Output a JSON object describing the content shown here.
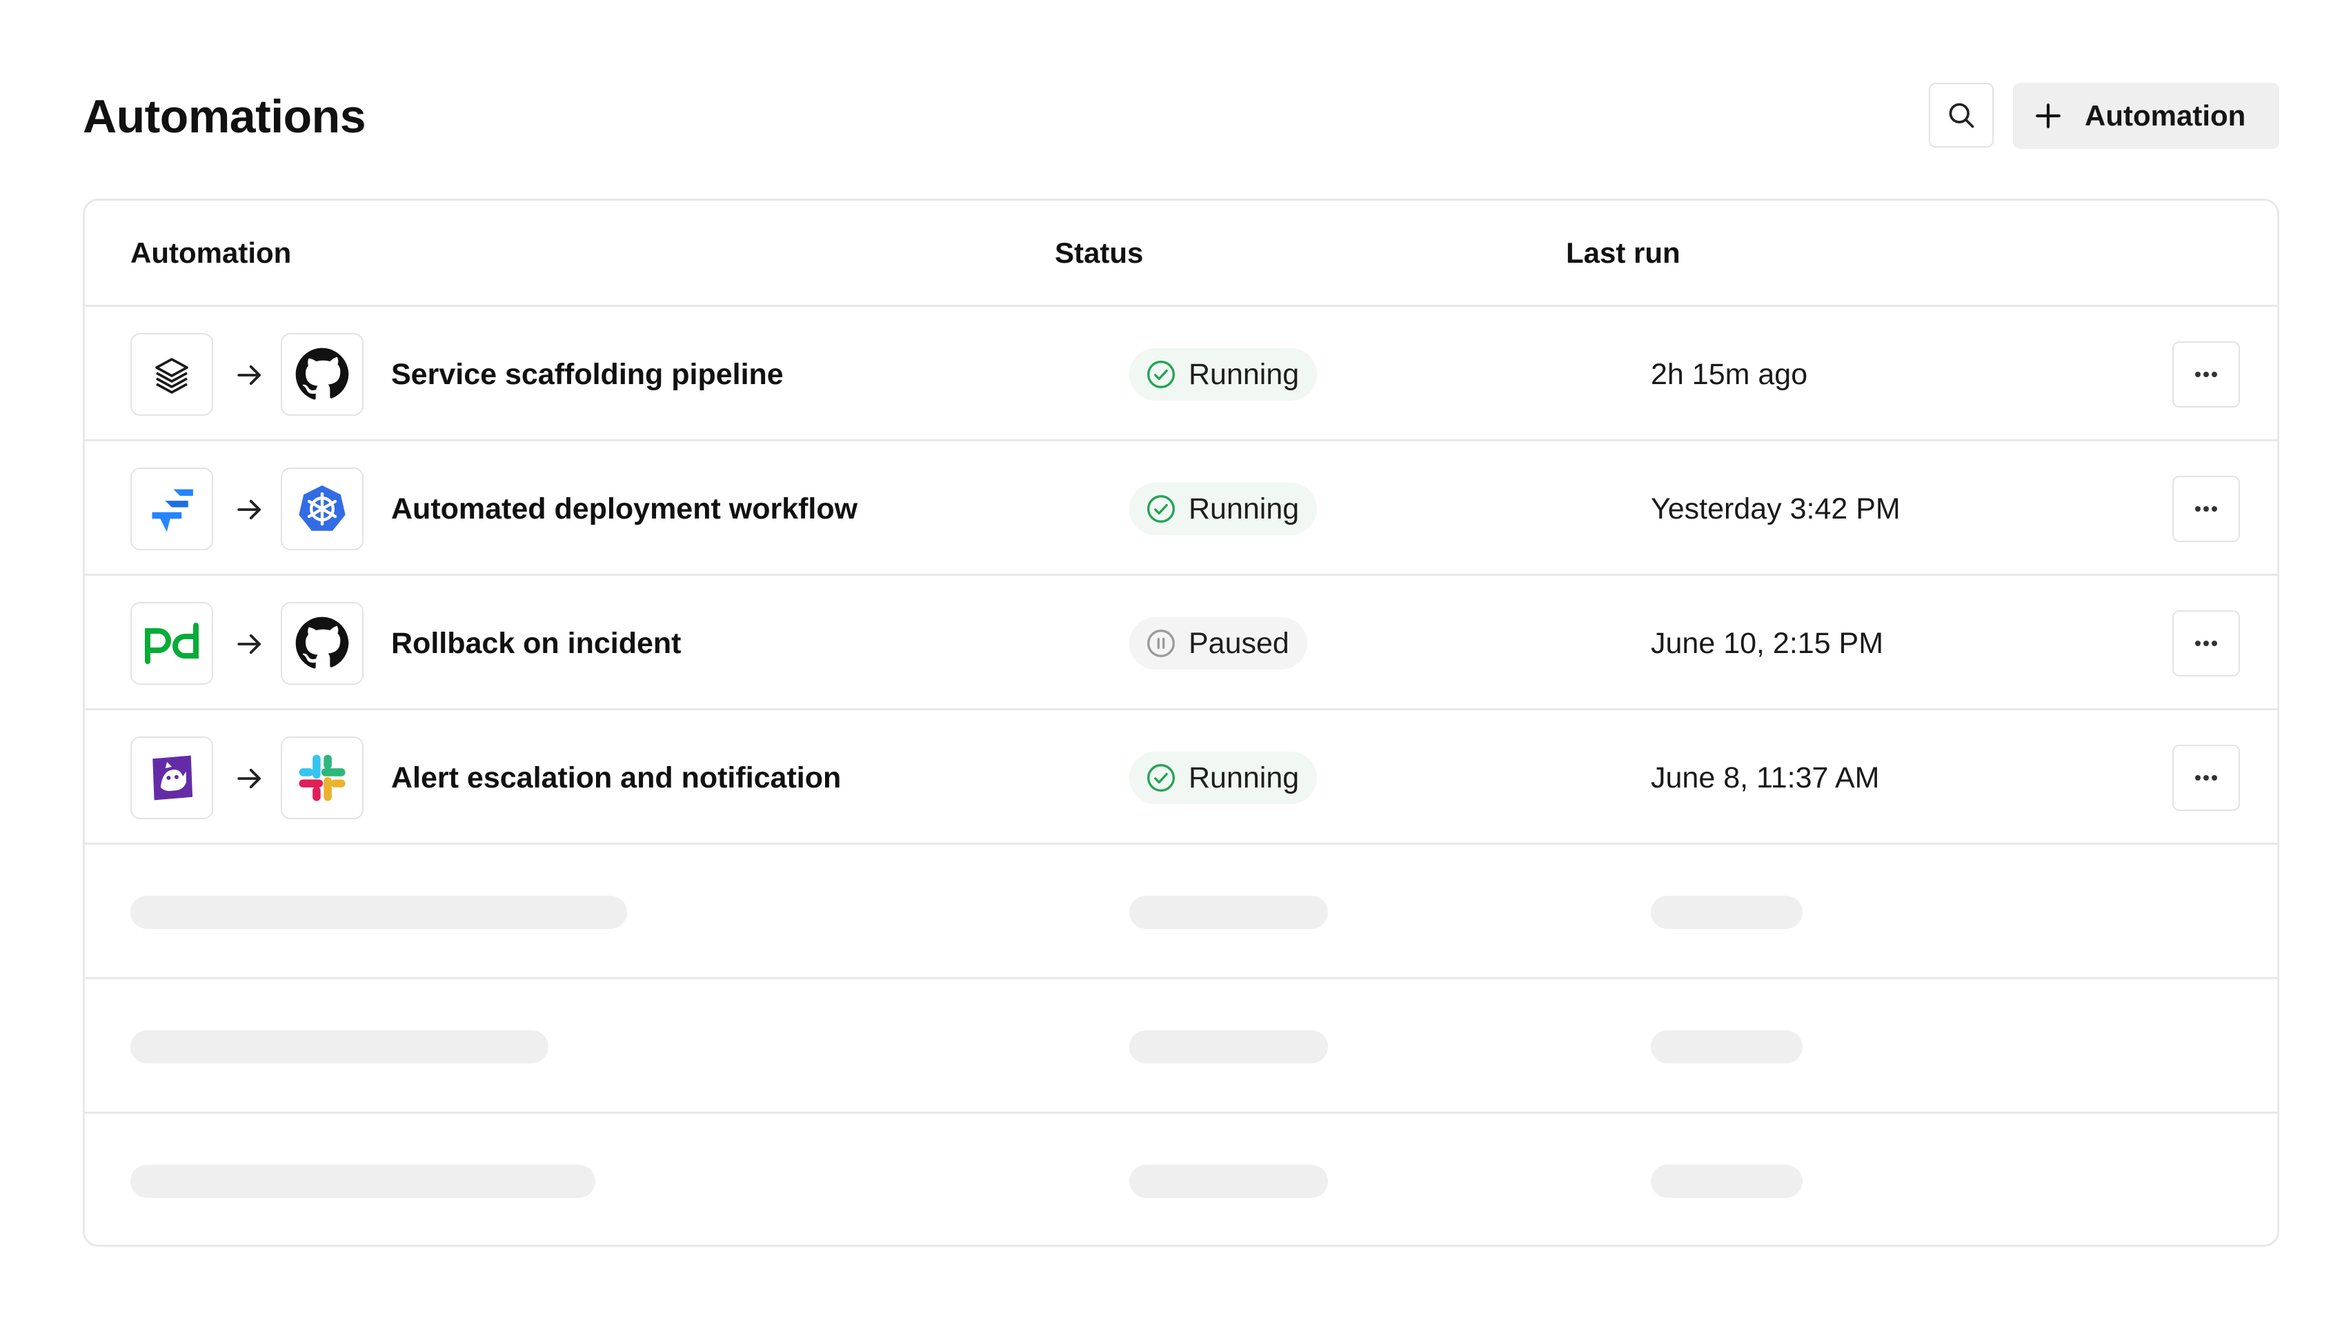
{
  "page": {
    "title": "Automations"
  },
  "toolbar": {
    "search_icon": "search-icon",
    "add_label": "Automation",
    "add_icon": "plus-icon"
  },
  "table": {
    "columns": [
      "Automation",
      "Status",
      "Last run"
    ],
    "rows": [
      {
        "source_icon": "layers-stack-icon",
        "target_icon": "github-icon",
        "name": "Service scaffolding pipeline",
        "status": "Running",
        "last_run": "2h 15m ago"
      },
      {
        "source_icon": "jira-icon",
        "target_icon": "kubernetes-icon",
        "name": "Automated deployment workflow",
        "status": "Running",
        "last_run": "Yesterday 3:42 PM"
      },
      {
        "source_icon": "pagerduty-icon",
        "target_icon": "github-icon",
        "name": "Rollback on incident",
        "status": "Paused",
        "last_run": "June 10, 2:15 PM"
      },
      {
        "source_icon": "datadog-icon",
        "target_icon": "slack-icon",
        "name": "Alert escalation and notification",
        "status": "Running",
        "last_run": "June 8, 11:37 AM"
      }
    ],
    "loading_rows": 3
  },
  "colors": {
    "running": "#22a355",
    "paused": "#9a9a9a",
    "jira_blue": "#2684ff",
    "kubernetes_blue": "#326ce5",
    "pagerduty_green": "#06ac38",
    "datadog_purple": "#632ca6"
  }
}
